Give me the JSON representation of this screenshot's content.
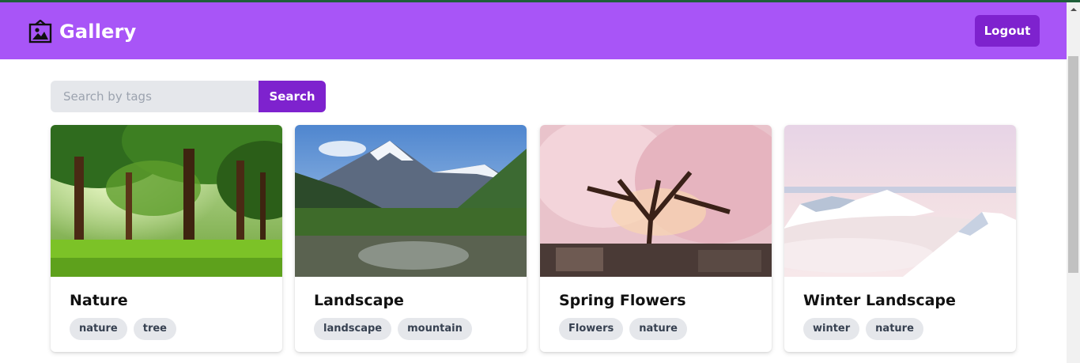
{
  "header": {
    "title": "Gallery",
    "logout_label": "Logout",
    "colors": {
      "navbar": "#a855f7",
      "button": "#7e22ce"
    }
  },
  "search": {
    "placeholder": "Search by tags",
    "button_label": "Search"
  },
  "cards": [
    {
      "title": "Nature",
      "image": "forest-trees-photo",
      "tags": [
        "nature",
        "tree"
      ]
    },
    {
      "title": "Landscape",
      "image": "mountain-valley-photo",
      "tags": [
        "landscape",
        "mountain"
      ]
    },
    {
      "title": "Spring Flowers",
      "image": "cherry-blossom-tree-photo",
      "tags": [
        "Flowers",
        "nature"
      ]
    },
    {
      "title": "Winter Landscape",
      "image": "snowy-mountains-clouds-photo",
      "tags": [
        "winter",
        "nature"
      ]
    }
  ]
}
